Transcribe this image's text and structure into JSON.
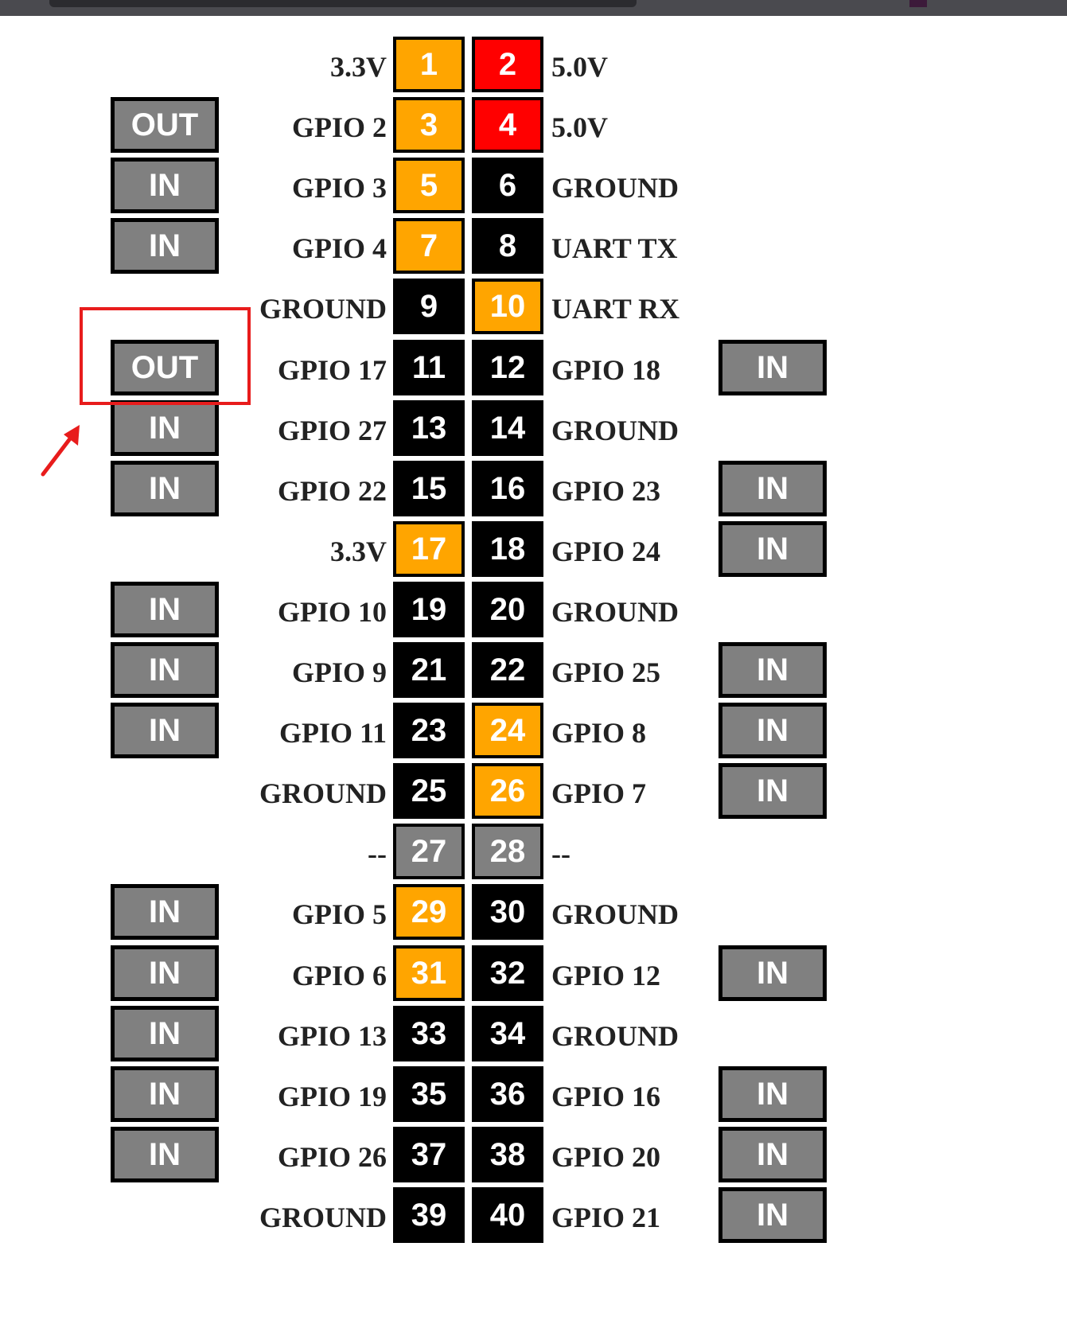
{
  "header": {
    "pins": [
      {
        "left_mode": "",
        "left_label": "3.3V",
        "left_num": "1",
        "left_kind": "power33",
        "right_num": "2",
        "right_kind": "power5",
        "right_label": "5.0V",
        "right_mode": ""
      },
      {
        "left_mode": "OUT",
        "left_label": "GPIO 2",
        "left_num": "3",
        "left_kind": "special",
        "right_num": "4",
        "right_kind": "power5",
        "right_label": "5.0V",
        "right_mode": ""
      },
      {
        "left_mode": "IN",
        "left_label": "GPIO 3",
        "left_num": "5",
        "left_kind": "special",
        "right_num": "6",
        "right_kind": "ground",
        "right_label": "GROUND",
        "right_mode": ""
      },
      {
        "left_mode": "IN",
        "left_label": "GPIO 4",
        "left_num": "7",
        "left_kind": "special",
        "right_num": "8",
        "right_kind": "gpio",
        "right_label": "UART TX",
        "right_mode": ""
      },
      {
        "left_mode": "",
        "left_label": "GROUND",
        "left_num": "9",
        "left_kind": "ground",
        "right_num": "10",
        "right_kind": "special",
        "right_label": "UART RX",
        "right_mode": ""
      },
      {
        "left_mode": "OUT",
        "left_label": "GPIO 17",
        "left_num": "11",
        "left_kind": "gpio",
        "right_num": "12",
        "right_kind": "gpio",
        "right_label": "GPIO 18",
        "right_mode": "IN"
      },
      {
        "left_mode": "IN",
        "left_label": "GPIO 27",
        "left_num": "13",
        "left_kind": "gpio",
        "right_num": "14",
        "right_kind": "ground",
        "right_label": "GROUND",
        "right_mode": ""
      },
      {
        "left_mode": "IN",
        "left_label": "GPIO 22",
        "left_num": "15",
        "left_kind": "gpio",
        "right_num": "16",
        "right_kind": "gpio",
        "right_label": "GPIO 23",
        "right_mode": "IN"
      },
      {
        "left_mode": "",
        "left_label": "3.3V",
        "left_num": "17",
        "left_kind": "power33",
        "right_num": "18",
        "right_kind": "gpio",
        "right_label": "GPIO 24",
        "right_mode": "IN"
      },
      {
        "left_mode": "IN",
        "left_label": "GPIO 10",
        "left_num": "19",
        "left_kind": "gpio",
        "right_num": "20",
        "right_kind": "ground",
        "right_label": "GROUND",
        "right_mode": ""
      },
      {
        "left_mode": "IN",
        "left_label": "GPIO 9",
        "left_num": "21",
        "left_kind": "gpio",
        "right_num": "22",
        "right_kind": "gpio",
        "right_label": "GPIO 25",
        "right_mode": "IN"
      },
      {
        "left_mode": "IN",
        "left_label": "GPIO 11",
        "left_num": "23",
        "left_kind": "gpio",
        "right_num": "24",
        "right_kind": "special",
        "right_label": "GPIO 8",
        "right_mode": "IN"
      },
      {
        "left_mode": "",
        "left_label": "GROUND",
        "left_num": "25",
        "left_kind": "ground",
        "right_num": "26",
        "right_kind": "special",
        "right_label": "GPIO 7",
        "right_mode": "IN"
      },
      {
        "left_mode": "",
        "left_label": "--",
        "left_num": "27",
        "left_kind": "dnc",
        "right_num": "28",
        "right_kind": "dnc",
        "right_label": "--",
        "right_mode": ""
      },
      {
        "left_mode": "IN",
        "left_label": "GPIO 5",
        "left_num": "29",
        "left_kind": "special",
        "right_num": "30",
        "right_kind": "ground",
        "right_label": "GROUND",
        "right_mode": ""
      },
      {
        "left_mode": "IN",
        "left_label": "GPIO 6",
        "left_num": "31",
        "left_kind": "special",
        "right_num": "32",
        "right_kind": "gpio",
        "right_label": "GPIO 12",
        "right_mode": "IN"
      },
      {
        "left_mode": "IN",
        "left_label": "GPIO 13",
        "left_num": "33",
        "left_kind": "gpio",
        "right_num": "34",
        "right_kind": "ground",
        "right_label": "GROUND",
        "right_mode": ""
      },
      {
        "left_mode": "IN",
        "left_label": "GPIO 19",
        "left_num": "35",
        "left_kind": "gpio",
        "right_num": "36",
        "right_kind": "gpio",
        "right_label": "GPIO 16",
        "right_mode": "IN"
      },
      {
        "left_mode": "IN",
        "left_label": "GPIO 26",
        "left_num": "37",
        "left_kind": "gpio",
        "right_num": "38",
        "right_kind": "gpio",
        "right_label": "GPIO 20",
        "right_mode": "IN"
      },
      {
        "left_mode": "",
        "left_label": "GROUND",
        "left_num": "39",
        "left_kind": "ground",
        "right_num": "40",
        "right_kind": "gpio",
        "right_label": "GPIO 21",
        "right_mode": "IN"
      }
    ]
  },
  "colors": {
    "power33": "#FFA500",
    "power5": "#FF0000",
    "ground": "#000000",
    "gpio": "#000000",
    "dnc": "#808080",
    "mode_button": "#808080",
    "annotation": "#e81c1c"
  },
  "icons": {
    "annotation_arrow": "arrow-up-right-icon"
  }
}
